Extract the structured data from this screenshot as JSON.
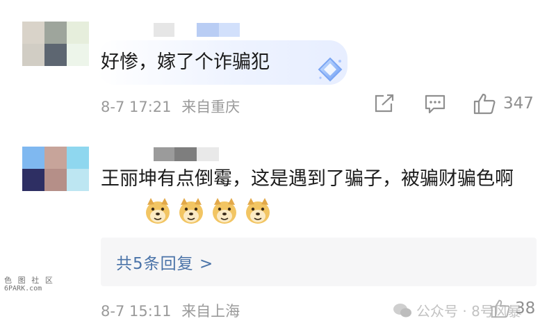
{
  "comments": [
    {
      "text": "好惨，嫁了个诈骗犯",
      "time": "8-7 17:21",
      "location": "来自重庆",
      "likes": "347",
      "avatar_colors": [
        "#d9d3c9",
        "#9ea59c",
        "#e6eedc",
        "#d1cdc4",
        "#5d6671",
        "#edf5ea"
      ],
      "name_colors": [
        "#e6e6e6",
        "#ffffff",
        "#b9cdf4",
        "#d2e0fb"
      ],
      "badge": "diamond-badge"
    },
    {
      "text": "王丽坤有点倒霉，这是遇到了骗子，被骗财骗色啊",
      "time": "8-7 15:11",
      "location": "来自上海",
      "replies": "共5条回复 >",
      "avatar_colors": [
        "#7fb8f0",
        "#c7a49a",
        "#8fd7ef",
        "#2e2f63",
        "#b58f88",
        "#bde6f2"
      ],
      "name_colors": [
        "#9b9b9b",
        "#7e7e7e",
        "#e9e9e9"
      ],
      "emoji_count": 4
    }
  ],
  "watermark": {
    "site_logo": "色 图 社 区",
    "site_url": "6PARK.com",
    "account": "公众号 · 8号风暴",
    "partial_number": "38"
  },
  "colors": {
    "meta": "#9a9a9a",
    "link": "#4a73a8",
    "reply_bg": "#f6f6f7"
  }
}
